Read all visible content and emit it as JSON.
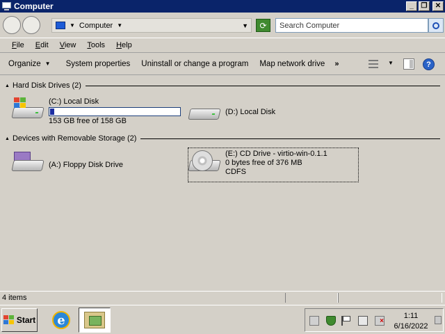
{
  "window": {
    "title": "Computer"
  },
  "caption_buttons": {
    "minimize": "_",
    "maximize": "❐",
    "close": "✕"
  },
  "address_bar": {
    "breadcrumb": "Computer",
    "search_placeholder": "Search Computer"
  },
  "menu": [
    {
      "label": "File",
      "accel": "F",
      "rest": "ile"
    },
    {
      "label": "Edit",
      "accel": "E",
      "rest": "dit"
    },
    {
      "label": "View",
      "accel": "V",
      "rest": "iew"
    },
    {
      "label": "Tools",
      "accel": "T",
      "rest": "ools"
    },
    {
      "label": "Help",
      "accel": "H",
      "rest": "elp"
    }
  ],
  "commands": {
    "organize": "Organize",
    "system_properties": "System properties",
    "uninstall": "Uninstall or change a program",
    "map_drive": "Map network drive",
    "more": "»"
  },
  "groups": {
    "hard_disks": {
      "label": "Hard Disk Drives (2)"
    },
    "removable": {
      "label": "Devices with Removable Storage (2)"
    }
  },
  "drives": {
    "c": {
      "name": "(C:) Local Disk",
      "free_text": "153 GB free of 158 GB",
      "used_fraction": 0.03
    },
    "d": {
      "name": "(D:) Local Disk"
    },
    "a": {
      "name": "(A:) Floppy Disk Drive"
    },
    "e": {
      "name": "(E:) CD Drive - virtio-win-0.1.1",
      "free_text": "0 bytes free of 376 MB",
      "fs": "CDFS"
    }
  },
  "status_bar": {
    "text": "4 items"
  },
  "taskbar": {
    "start_label": "Start",
    "clock_time": "1:11",
    "clock_date": "6/16/2022"
  },
  "icons": {
    "app": "computer-icon",
    "search": "search-icon",
    "refresh": "refresh-icon",
    "help": "help-icon",
    "ie": "internet-explorer-icon"
  }
}
